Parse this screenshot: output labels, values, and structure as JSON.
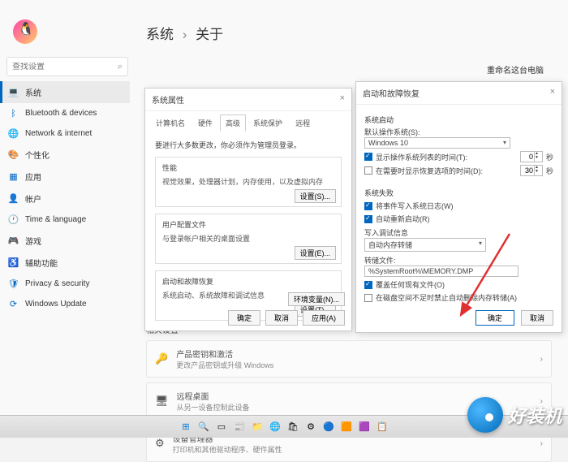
{
  "header": {
    "crumb1": "系统",
    "crumb2": "关于"
  },
  "search": {
    "placeholder": "查找设置"
  },
  "rename": "重命名这台电脑",
  "sidebar": {
    "items": [
      {
        "icon": "💻",
        "label": "系统",
        "color": "#555"
      },
      {
        "icon": "ᛒ",
        "label": "Bluetooth & devices",
        "color": "#0067c0"
      },
      {
        "icon": "🌐",
        "label": "Network & internet",
        "color": "#0067c0"
      },
      {
        "icon": "🎨",
        "label": "个性化",
        "color": "#d04a8a"
      },
      {
        "icon": "▦",
        "label": "应用",
        "color": "#0067c0"
      },
      {
        "icon": "👤",
        "label": "帐户",
        "color": "#e09040"
      },
      {
        "icon": "🕐",
        "label": "Time & language",
        "color": "#555"
      },
      {
        "icon": "🎮",
        "label": "游戏",
        "color": "#0067c0"
      },
      {
        "icon": "♿",
        "label": "辅助功能",
        "color": "#0067c0"
      },
      {
        "icon": "🛡",
        "label": "Privacy & security",
        "color": "#0067c0"
      },
      {
        "icon": "⟳",
        "label": "Windows Update",
        "color": "#0067c0"
      }
    ]
  },
  "related": {
    "heading": "相关设置",
    "cards": [
      {
        "icon": "🔑",
        "title": "产品密钥和激活",
        "sub": "更改产品密钥或升级 Windows"
      },
      {
        "icon": "🖥",
        "title": "远程桌面",
        "sub": "从另一设备控制此设备"
      },
      {
        "icon": "⚙",
        "title": "设备管理器",
        "sub": "打印机和其他驱动程序、硬件属性"
      }
    ]
  },
  "dialog1": {
    "title": "系统属性",
    "tabs": [
      "计算机名",
      "硬件",
      "高级",
      "系统保护",
      "远程"
    ],
    "activeTab": 2,
    "note": "要进行大多数更改，你必须作为管理员登录。",
    "groups": [
      {
        "title": "性能",
        "desc": "视觉效果，处理器计划，内存使用，以及虚拟内存",
        "btn": "设置(S)..."
      },
      {
        "title": "用户配置文件",
        "desc": "与登录帐户相关的桌面设置",
        "btn": "设置(E)..."
      },
      {
        "title": "启动和故障恢复",
        "desc": "系统启动、系统故障和调试信息",
        "btn": "设置(T)..."
      }
    ],
    "envBtn": "环境变量(N)...",
    "footer": {
      "ok": "确定",
      "cancel": "取消",
      "apply": "应用(A)"
    }
  },
  "dialog2": {
    "title": "启动和故障恢复",
    "sec1": "系统启动",
    "defaultOsLabel": "默认操作系统(S):",
    "defaultOsValue": "Windows 10",
    "showList": {
      "label": "显示操作系统列表的时间(T):",
      "value": "0",
      "unit": "秒"
    },
    "showRecovery": {
      "label": "在需要时显示恢复选项的时间(D):",
      "value": "30",
      "unit": "秒"
    },
    "sec2": "系统失败",
    "writeLog": "将事件写入系统日志(W)",
    "autoRestart": "自动重新启动(R)",
    "writeDebugLabel": "写入调试信息",
    "writeDebugValue": "自动内存转储",
    "dumpLabel": "转储文件:",
    "dumpValue": "%SystemRoot%\\MEMORY.DMP",
    "overwrite": "覆盖任何现有文件(O)",
    "lowDisk": "在磁盘空间不足时禁止自动删除内存转储(A)",
    "footer": {
      "ok": "确定",
      "cancel": "取消"
    }
  },
  "watermark": "好装机"
}
